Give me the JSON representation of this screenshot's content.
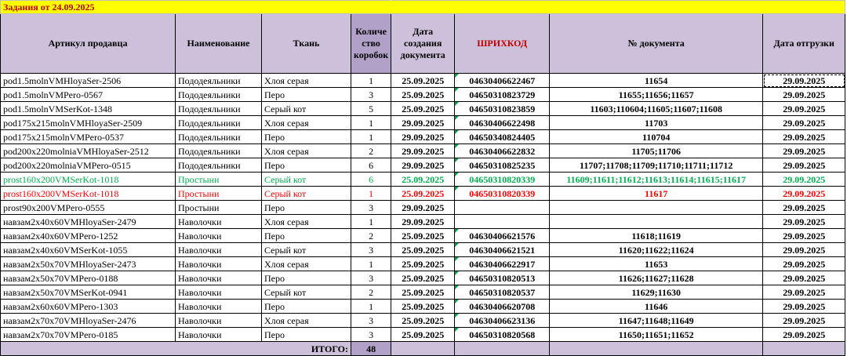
{
  "title": "Задания от 24.09.2025",
  "headers": {
    "sku": "Артикул продавца",
    "name": "Наименование",
    "fabric": "Ткань",
    "qty": "Количе ство коробок",
    "created": "Дата создания документа",
    "barcode": "ШРИХКОД",
    "docnum": "№ документа",
    "ship": "Дата отгрузки"
  },
  "rows": [
    {
      "sku": "pod1.5molnVMHloyaSer-2506",
      "name": "Пододеяльники",
      "fabric": "Хлоя серая",
      "qty": "1",
      "created": "25.09.2025",
      "barcode": "04630406622467",
      "docnum": "11654",
      "ship": "29.09.2025",
      "style": "normal"
    },
    {
      "sku": "pod1.5molnVMPero-0567",
      "name": "Пододеяльники",
      "fabric": "Перо",
      "qty": "3",
      "created": "25.09.2025",
      "barcode": "04650310823729",
      "docnum": "11655;11656;11657",
      "ship": "29.09.2025",
      "style": "normal"
    },
    {
      "sku": "pod1.5molnVMSerKot-1348",
      "name": "Пододеяльники",
      "fabric": "Серый кот",
      "qty": "5",
      "created": "25.09.2025",
      "barcode": "04650310823859",
      "docnum": "11603;110604;11605;11607;11608",
      "ship": "29.09.2025",
      "style": "normal"
    },
    {
      "sku": "pod175x215molnVMHloyaSer-2509",
      "name": "Пододеяльники",
      "fabric": "Хлоя серая",
      "qty": "1",
      "created": "29.09.2025",
      "barcode": "04630406622498",
      "docnum": "11703",
      "ship": "29.09.2025",
      "style": "normal"
    },
    {
      "sku": "pod175x215molnVMPero-0537",
      "name": "Пододеяльники",
      "fabric": "Перо",
      "qty": "1",
      "created": "29.09.2025",
      "barcode": "04650340824405",
      "docnum": "110704",
      "ship": "29.09.2025",
      "style": "normal"
    },
    {
      "sku": "pod200x220molniaVMHloyaSer-2512",
      "name": "Пододеяльники",
      "fabric": "Хлоя серая",
      "qty": "2",
      "created": "29.09.2025",
      "barcode": "04630406622832",
      "docnum": "11705;11706",
      "ship": "29.09.2025",
      "style": "normal"
    },
    {
      "sku": "pod200x220molniaVMPero-0515",
      "name": "Пододеяльники",
      "fabric": "Перо",
      "qty": "6",
      "created": "29.09.2025",
      "barcode": "04650310825235",
      "docnum": "11707;11708;11709;11710;11711;11712",
      "ship": "29.09.2025",
      "style": "normal"
    },
    {
      "sku": "prost160x200VMSerKot-1018",
      "name": "Простыни",
      "fabric": "Серый кот",
      "qty": "6",
      "created": "25.09.2025",
      "barcode": "04650310820339",
      "docnum": "11609;11611;11612;11613;11614;11615;11617",
      "ship": "29.09.2025",
      "style": "green"
    },
    {
      "sku": "prost160x200VMSerKot-1018",
      "name": "Простыни",
      "fabric": "Серый кот",
      "qty": "1",
      "created": "25.09.2025",
      "barcode": "04650310820339",
      "docnum": "11617",
      "ship": "29.09.2025",
      "style": "red"
    },
    {
      "sku": "prost90x200VMPero-0555",
      "name": "Простыни",
      "fabric": "Перо",
      "qty": "3",
      "created": "29.09.2025",
      "barcode": "",
      "docnum": "",
      "ship": "29.09.2025",
      "style": "normal"
    },
    {
      "sku": "навзам2х40х60VMHloyaSer-2479",
      "name": "Наволочки",
      "fabric": "Хлоя серая",
      "qty": "1",
      "created": "29.09.2025",
      "barcode": "",
      "docnum": "",
      "ship": "29.09.2025",
      "style": "normal"
    },
    {
      "sku": "навзам2х40х60VMPero-1252",
      "name": "Наволочки",
      "fabric": "Перо",
      "qty": "2",
      "created": "25.09.2025",
      "barcode": "04630406621576",
      "docnum": "11618;11619",
      "ship": "29.09.2025",
      "style": "normal"
    },
    {
      "sku": "навзам2х40х60VMSerKot-1055",
      "name": "Наволочки",
      "fabric": "Серый кот",
      "qty": "3",
      "created": "25.09.2025",
      "barcode": "04630406621521",
      "docnum": "11620;11622;11624",
      "ship": "29.09.2025",
      "style": "normal"
    },
    {
      "sku": "навзам2х50х70VMHloyaSer-2473",
      "name": "Наволочки",
      "fabric": "Хлоя серая",
      "qty": "1",
      "created": "25.09.2025",
      "barcode": "04630406622917",
      "docnum": "11653",
      "ship": "29.09.2025",
      "style": "normal"
    },
    {
      "sku": "навзам2х50х70VMPero-0188",
      "name": "Наволочки",
      "fabric": "Перо",
      "qty": "3",
      "created": "25.09.2025",
      "barcode": "04650310820513",
      "docnum": "11626;11627;11628",
      "ship": "29.09.2025",
      "style": "normal"
    },
    {
      "sku": "навзам2х50х70VMSerKot-0941",
      "name": "Наволочки",
      "fabric": "Серый кот",
      "qty": "2",
      "created": "25.09.2025",
      "barcode": "04650310820537",
      "docnum": "11629;11630",
      "ship": "29.09.2025",
      "style": "normal"
    },
    {
      "sku": "навзам2х60х60VMPero-1303",
      "name": "Наволочки",
      "fabric": "Перо",
      "qty": "1",
      "created": "25.09.2025",
      "barcode": "04630406620708",
      "docnum": "11646",
      "ship": "29.09.2025",
      "style": "normal"
    },
    {
      "sku": "навзам2х70х70VMHloyaSer-2476",
      "name": "Наволочки",
      "fabric": "Хлоя серая",
      "qty": "3",
      "created": "25.09.2025",
      "barcode": "04630406623136",
      "docnum": "11647;11648;11649",
      "ship": "29.09.2025",
      "style": "normal"
    },
    {
      "sku": "навзам2х70х70VMPero-0185",
      "name": "Наволочки",
      "fabric": "Перо",
      "qty": "3",
      "created": "25.09.2025",
      "barcode": "04650310820568",
      "docnum": "11650;11651;11652",
      "ship": "29.09.2025",
      "style": "normal"
    }
  ],
  "total": {
    "label": "ИТОГО:",
    "value": "48"
  },
  "colors": {
    "title_bg": "#ffff00",
    "title_text": "#c00000",
    "header_bg": "#ccc0da",
    "qty_header_bg": "#b1a0c7",
    "green_text": "#00b050",
    "red_text": "#ff0000"
  }
}
